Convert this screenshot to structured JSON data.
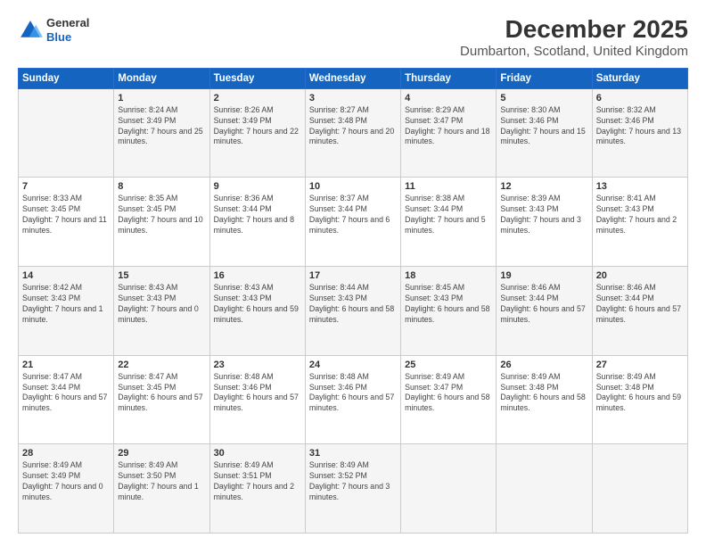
{
  "logo": {
    "line1": "General",
    "line2": "Blue"
  },
  "title": "December 2025",
  "subtitle": "Dumbarton, Scotland, United Kingdom",
  "weekdays": [
    "Sunday",
    "Monday",
    "Tuesday",
    "Wednesday",
    "Thursday",
    "Friday",
    "Saturday"
  ],
  "rows": [
    [
      {
        "day": "",
        "sunrise": "",
        "sunset": "",
        "daylight": ""
      },
      {
        "day": "1",
        "sunrise": "Sunrise: 8:24 AM",
        "sunset": "Sunset: 3:49 PM",
        "daylight": "Daylight: 7 hours and 25 minutes."
      },
      {
        "day": "2",
        "sunrise": "Sunrise: 8:26 AM",
        "sunset": "Sunset: 3:49 PM",
        "daylight": "Daylight: 7 hours and 22 minutes."
      },
      {
        "day": "3",
        "sunrise": "Sunrise: 8:27 AM",
        "sunset": "Sunset: 3:48 PM",
        "daylight": "Daylight: 7 hours and 20 minutes."
      },
      {
        "day": "4",
        "sunrise": "Sunrise: 8:29 AM",
        "sunset": "Sunset: 3:47 PM",
        "daylight": "Daylight: 7 hours and 18 minutes."
      },
      {
        "day": "5",
        "sunrise": "Sunrise: 8:30 AM",
        "sunset": "Sunset: 3:46 PM",
        "daylight": "Daylight: 7 hours and 15 minutes."
      },
      {
        "day": "6",
        "sunrise": "Sunrise: 8:32 AM",
        "sunset": "Sunset: 3:46 PM",
        "daylight": "Daylight: 7 hours and 13 minutes."
      }
    ],
    [
      {
        "day": "7",
        "sunrise": "Sunrise: 8:33 AM",
        "sunset": "Sunset: 3:45 PM",
        "daylight": "Daylight: 7 hours and 11 minutes."
      },
      {
        "day": "8",
        "sunrise": "Sunrise: 8:35 AM",
        "sunset": "Sunset: 3:45 PM",
        "daylight": "Daylight: 7 hours and 10 minutes."
      },
      {
        "day": "9",
        "sunrise": "Sunrise: 8:36 AM",
        "sunset": "Sunset: 3:44 PM",
        "daylight": "Daylight: 7 hours and 8 minutes."
      },
      {
        "day": "10",
        "sunrise": "Sunrise: 8:37 AM",
        "sunset": "Sunset: 3:44 PM",
        "daylight": "Daylight: 7 hours and 6 minutes."
      },
      {
        "day": "11",
        "sunrise": "Sunrise: 8:38 AM",
        "sunset": "Sunset: 3:44 PM",
        "daylight": "Daylight: 7 hours and 5 minutes."
      },
      {
        "day": "12",
        "sunrise": "Sunrise: 8:39 AM",
        "sunset": "Sunset: 3:43 PM",
        "daylight": "Daylight: 7 hours and 3 minutes."
      },
      {
        "day": "13",
        "sunrise": "Sunrise: 8:41 AM",
        "sunset": "Sunset: 3:43 PM",
        "daylight": "Daylight: 7 hours and 2 minutes."
      }
    ],
    [
      {
        "day": "14",
        "sunrise": "Sunrise: 8:42 AM",
        "sunset": "Sunset: 3:43 PM",
        "daylight": "Daylight: 7 hours and 1 minute."
      },
      {
        "day": "15",
        "sunrise": "Sunrise: 8:43 AM",
        "sunset": "Sunset: 3:43 PM",
        "daylight": "Daylight: 7 hours and 0 minutes."
      },
      {
        "day": "16",
        "sunrise": "Sunrise: 8:43 AM",
        "sunset": "Sunset: 3:43 PM",
        "daylight": "Daylight: 6 hours and 59 minutes."
      },
      {
        "day": "17",
        "sunrise": "Sunrise: 8:44 AM",
        "sunset": "Sunset: 3:43 PM",
        "daylight": "Daylight: 6 hours and 58 minutes."
      },
      {
        "day": "18",
        "sunrise": "Sunrise: 8:45 AM",
        "sunset": "Sunset: 3:43 PM",
        "daylight": "Daylight: 6 hours and 58 minutes."
      },
      {
        "day": "19",
        "sunrise": "Sunrise: 8:46 AM",
        "sunset": "Sunset: 3:44 PM",
        "daylight": "Daylight: 6 hours and 57 minutes."
      },
      {
        "day": "20",
        "sunrise": "Sunrise: 8:46 AM",
        "sunset": "Sunset: 3:44 PM",
        "daylight": "Daylight: 6 hours and 57 minutes."
      }
    ],
    [
      {
        "day": "21",
        "sunrise": "Sunrise: 8:47 AM",
        "sunset": "Sunset: 3:44 PM",
        "daylight": "Daylight: 6 hours and 57 minutes."
      },
      {
        "day": "22",
        "sunrise": "Sunrise: 8:47 AM",
        "sunset": "Sunset: 3:45 PM",
        "daylight": "Daylight: 6 hours and 57 minutes."
      },
      {
        "day": "23",
        "sunrise": "Sunrise: 8:48 AM",
        "sunset": "Sunset: 3:46 PM",
        "daylight": "Daylight: 6 hours and 57 minutes."
      },
      {
        "day": "24",
        "sunrise": "Sunrise: 8:48 AM",
        "sunset": "Sunset: 3:46 PM",
        "daylight": "Daylight: 6 hours and 57 minutes."
      },
      {
        "day": "25",
        "sunrise": "Sunrise: 8:49 AM",
        "sunset": "Sunset: 3:47 PM",
        "daylight": "Daylight: 6 hours and 58 minutes."
      },
      {
        "day": "26",
        "sunrise": "Sunrise: 8:49 AM",
        "sunset": "Sunset: 3:48 PM",
        "daylight": "Daylight: 6 hours and 58 minutes."
      },
      {
        "day": "27",
        "sunrise": "Sunrise: 8:49 AM",
        "sunset": "Sunset: 3:48 PM",
        "daylight": "Daylight: 6 hours and 59 minutes."
      }
    ],
    [
      {
        "day": "28",
        "sunrise": "Sunrise: 8:49 AM",
        "sunset": "Sunset: 3:49 PM",
        "daylight": "Daylight: 7 hours and 0 minutes."
      },
      {
        "day": "29",
        "sunrise": "Sunrise: 8:49 AM",
        "sunset": "Sunset: 3:50 PM",
        "daylight": "Daylight: 7 hours and 1 minute."
      },
      {
        "day": "30",
        "sunrise": "Sunrise: 8:49 AM",
        "sunset": "Sunset: 3:51 PM",
        "daylight": "Daylight: 7 hours and 2 minutes."
      },
      {
        "day": "31",
        "sunrise": "Sunrise: 8:49 AM",
        "sunset": "Sunset: 3:52 PM",
        "daylight": "Daylight: 7 hours and 3 minutes."
      },
      {
        "day": "",
        "sunrise": "",
        "sunset": "",
        "daylight": ""
      },
      {
        "day": "",
        "sunrise": "",
        "sunset": "",
        "daylight": ""
      },
      {
        "day": "",
        "sunrise": "",
        "sunset": "",
        "daylight": ""
      }
    ]
  ]
}
